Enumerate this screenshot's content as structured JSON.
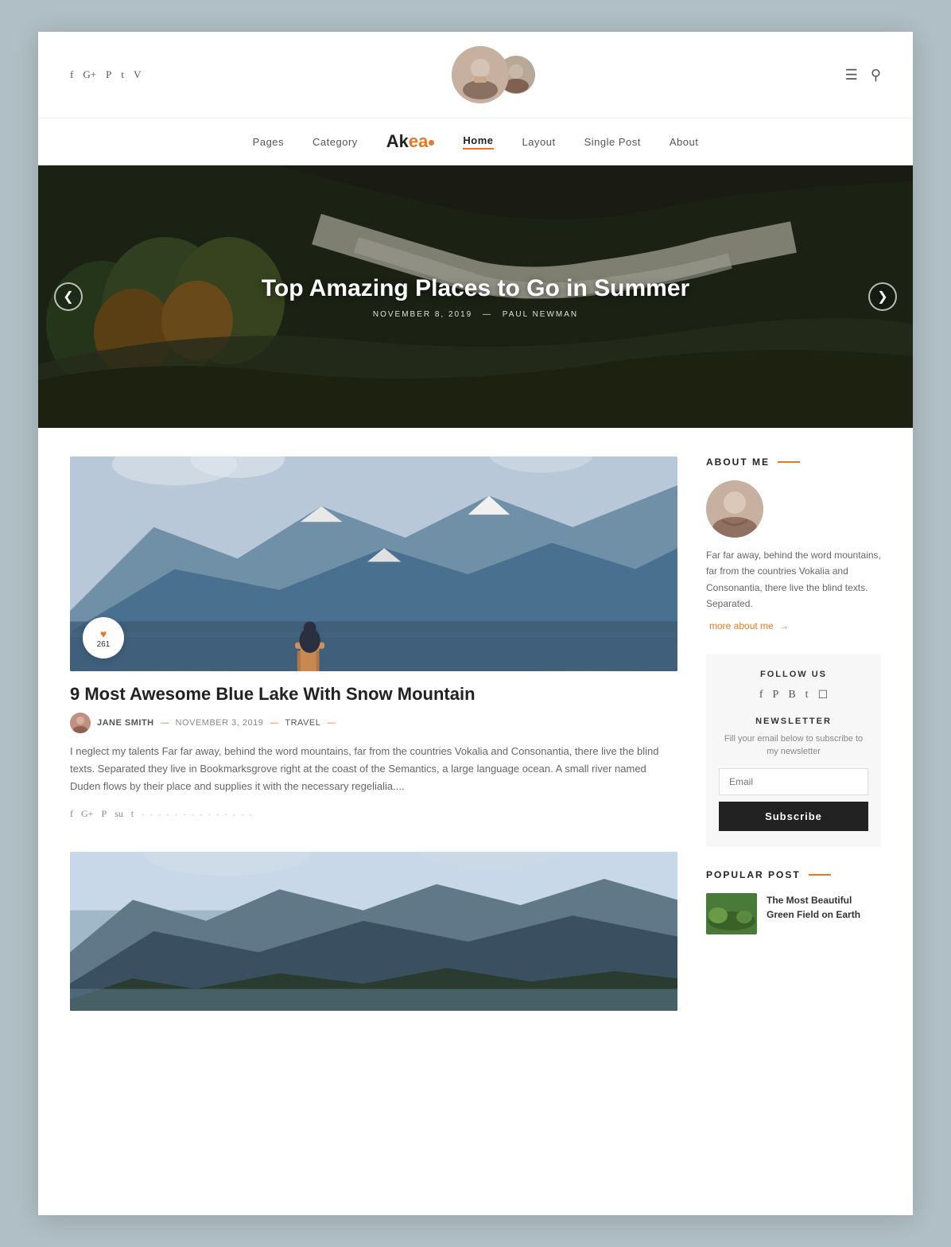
{
  "header": {
    "social_icons": [
      "f",
      "G+",
      "P",
      "t",
      "V"
    ],
    "menu_icon": "☰",
    "search_icon": "🔍"
  },
  "nav": {
    "items": [
      "Home",
      "Pages",
      "Category",
      "Layout",
      "Single Post",
      "About"
    ],
    "active": "Home",
    "logo_text": "Akea",
    "logo_dot": "●"
  },
  "hero": {
    "title": "Top Amazing Places to Go in Summer",
    "date": "NOVEMBER 8, 2019",
    "author": "PAUL NEWMAN",
    "arrow_left": "❮",
    "arrow_right": "❯"
  },
  "post1": {
    "likes": "261",
    "heart": "♥",
    "title": "9 Most Awesome Blue Lake With Snow Mountain",
    "author_name": "JANE SMITH",
    "date": "NOVEMBER 3, 2019",
    "category": "TRAVEL",
    "excerpt": "I neglect my talents Far far away, behind the word mountains, far from the countries Vokalia and Consonantia, there live the blind texts. Separated they live in Bookmarksgrove right at the coast of the Semantics, a large language ocean. A small river named Duden flows by their place and supplies it with the necessary regelialia....",
    "share_icons": [
      "f",
      "G+",
      "P",
      "su",
      "t"
    ],
    "share_dots": "- - - - - - - - - - - - - -"
  },
  "sidebar": {
    "about_title": "ABOUT ME",
    "about_text": "Far far away, behind the word mountains, far from the countries Vokalia and Consonantia, there live the blind texts. Separated.",
    "more_about": "more about me",
    "more_arrow": "→",
    "follow_title": "FOLLOW US",
    "follow_icons": [
      "f",
      "P",
      "B",
      "t",
      "◻"
    ],
    "newsletter_title": "NEWSLETTER",
    "newsletter_desc": "Fill your email below to subscribe to my newsletter",
    "email_placeholder": "Email",
    "subscribe_label": "Subscribe",
    "popular_title": "POPULAR POST",
    "popular_items": [
      {
        "title": "The Most Beautiful Green Field on Earth",
        "thumb_color": "#5a8a40"
      }
    ]
  }
}
